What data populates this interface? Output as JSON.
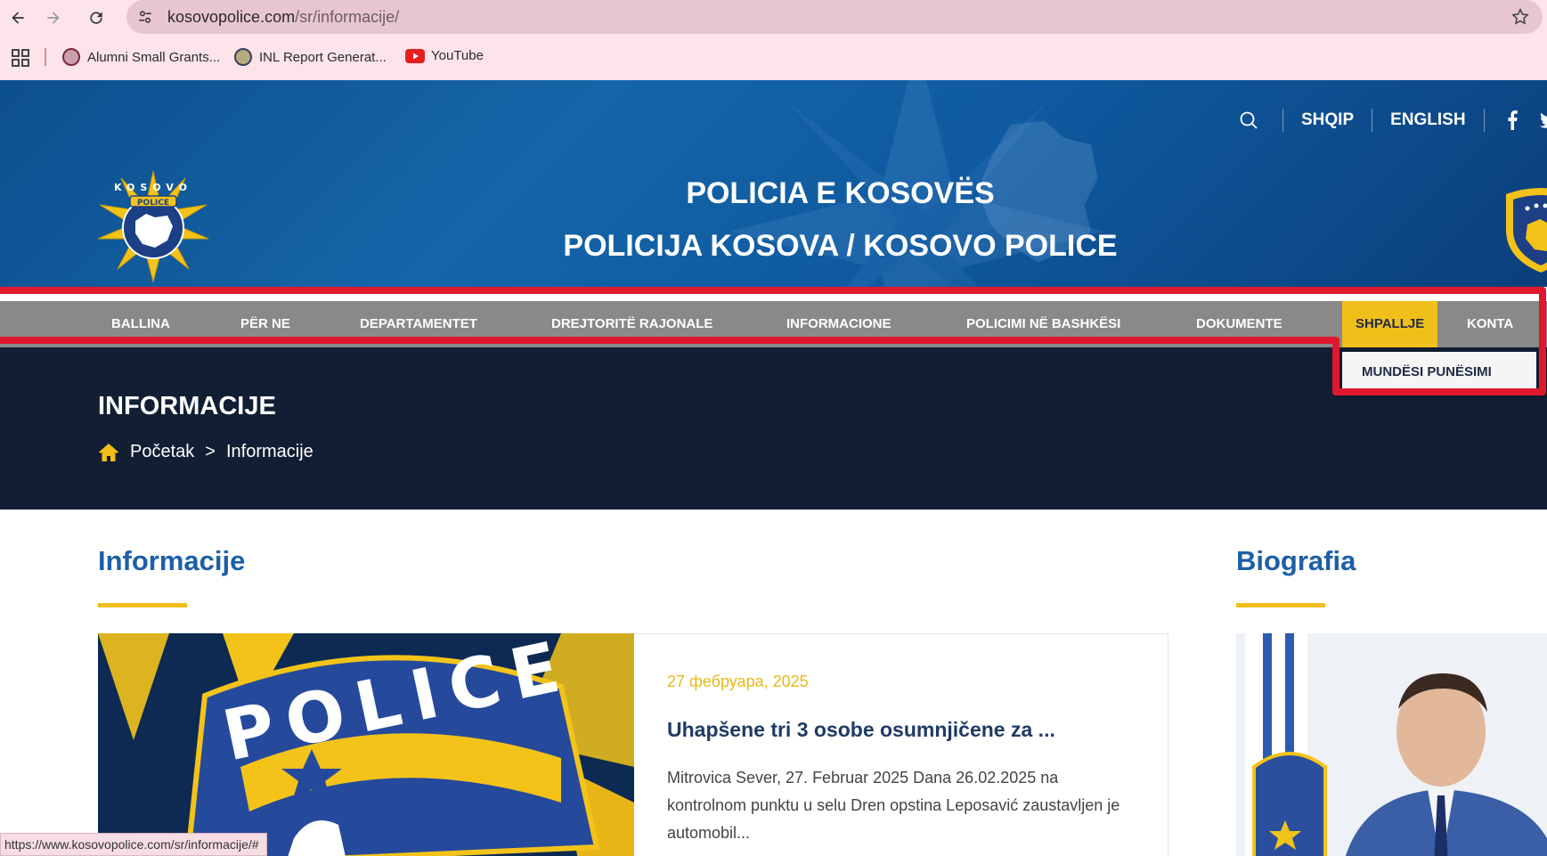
{
  "browser": {
    "url_host": "kosovopolice.com",
    "url_path": "/sr/informacije/",
    "bookmarks": [
      {
        "label": "Alumni Small Grants..."
      },
      {
        "label": "INL Report Generat..."
      },
      {
        "label": "YouTube"
      }
    ],
    "status_url": "https://www.kosovopolice.com/sr/informacije/#"
  },
  "header": {
    "lang_sq": "SHQIP",
    "lang_en": "ENGLISH",
    "title_line1": "POLICIA E KOSOVËS",
    "title_line2": "POLICIJA KOSOVA / KOSOVO POLICE",
    "logo_text": "KOSOVO",
    "logo_band": "POLICE"
  },
  "nav": {
    "items": [
      {
        "label": "BALLINA"
      },
      {
        "label": "PËR NE"
      },
      {
        "label": "DEPARTAMENTET"
      },
      {
        "label": "DREJTORITË RAJONALE"
      },
      {
        "label": "INFORMACIONE"
      },
      {
        "label": "POLICIMI NË BASHKËSI"
      },
      {
        "label": "DOKUMENTE"
      },
      {
        "label": "SHPALLJE"
      },
      {
        "label": "KONTA"
      }
    ],
    "dropdown_item": "MUNDËSI PUNËSIMI"
  },
  "banner": {
    "title": "INFORMACIJE",
    "breadcrumb_home": "Početak",
    "breadcrumb_sep": ">",
    "breadcrumb_current": "Informacije"
  },
  "main": {
    "section_title": "Informacije",
    "article": {
      "date": "27 фебруара, 2025",
      "title": "Uhapšene tri 3 osobe osumnjičene za ...",
      "excerpt": "Mitrovica Sever, 27. Februar 2025 Dana 26.02.2025 na kontrolnom punktu u selu Dren opstina Leposavić zaustavljen je automobil...",
      "image_text": "POLICE"
    }
  },
  "sidebar": {
    "section_title": "Biografia"
  },
  "colors": {
    "accent_yellow": "#f0bf1a",
    "header_blue": "#1565a8",
    "banner_navy": "#111e33",
    "nav_gray": "#898989",
    "title_blue": "#1d5fa6",
    "highlight_red": "#e0182d"
  }
}
